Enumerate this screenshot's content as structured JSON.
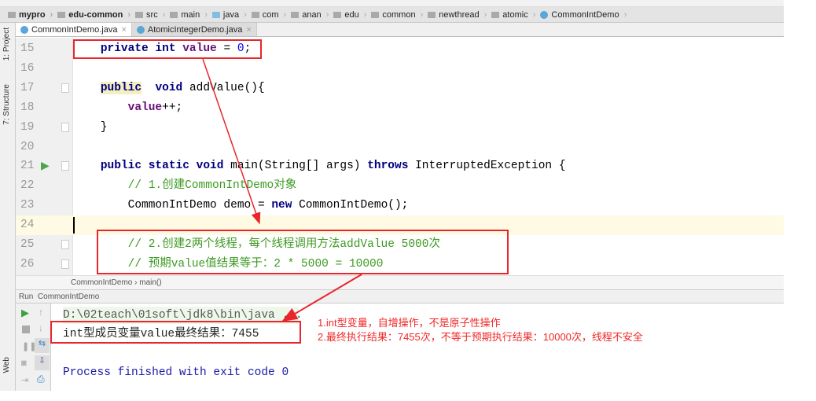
{
  "breadcrumbs": [
    "mypro",
    "edu-common",
    "src",
    "main",
    "java",
    "com",
    "anan",
    "edu",
    "common",
    "newthread",
    "atomic",
    "CommonIntDemo"
  ],
  "tabs": [
    {
      "label": "CommonIntDemo.java",
      "active": true
    },
    {
      "label": "AtomicIntegerDemo.java",
      "active": false
    }
  ],
  "side_tools": [
    "1: Project",
    "7: Structure",
    "Web"
  ],
  "code_lines": [
    {
      "n": "15",
      "html": "    <span class='kw'>private int </span><span class='fld'>value</span> = <span class='num'>0</span>;"
    },
    {
      "n": "16",
      "html": ""
    },
    {
      "n": "17",
      "html": "    <span class='kw' style='background:#f5eebf'>public</span>  <span class='kw'>void</span> addValue(){"
    },
    {
      "n": "18",
      "html": "        <span class='fld'>value</span>++;"
    },
    {
      "n": "19",
      "html": "    }"
    },
    {
      "n": "20",
      "html": ""
    },
    {
      "n": "21",
      "html": "    <span class='kw'>public static void</span> main(String[] args) <span class='kw'>throws</span> InterruptedException {"
    },
    {
      "n": "22",
      "html": "        <span class='cm'>// 1.创建CommonIntDemo对象</span>"
    },
    {
      "n": "23",
      "html": "        CommonIntDemo demo = <span class='kw'>new</span> CommonIntDemo();"
    },
    {
      "n": "24",
      "html": ""
    },
    {
      "n": "25",
      "html": "        <span class='cm'>// 2.创建2两个线程，每个线程调用方法addValue 5000次</span>"
    },
    {
      "n": "26",
      "html": "        <span class='cm'>// 预期value值结果等于：2 * 5000 = 10000</span>"
    }
  ],
  "editor_breadcrumb": [
    "CommonIntDemo",
    "main()"
  ],
  "run": {
    "label": "Run",
    "config": "CommonIntDemo"
  },
  "console": {
    "cmd": "D:\\02teach\\01soft\\jdk8\\bin\\java ...",
    "output": "int型成员变量value最终结果：7455",
    "exit": "Process finished with exit code 0"
  },
  "notes": [
    "1.int型变量，自增操作，不是原子性操作",
    "2.最终执行结果：7455次，不等于预期执行结果：10000次，线程不安全"
  ],
  "colors": {
    "annotation": "#e8262b",
    "keyword": "#000080",
    "field": "#660e7a",
    "comment": "#3d9b22"
  }
}
